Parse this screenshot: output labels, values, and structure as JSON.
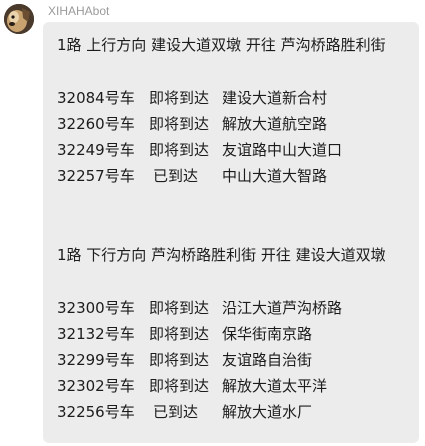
{
  "sender": {
    "name": "XIHAHAbot"
  },
  "message": {
    "up": {
      "header": "1路 上行方向 建设大道双墩 开往 芦沟桥路胜利街",
      "buses": [
        {
          "bus": "32084号车",
          "status": "即将到达",
          "location": "建设大道新合村"
        },
        {
          "bus": "32260号车",
          "status": "即将到达",
          "location": "解放大道航空路"
        },
        {
          "bus": "32249号车",
          "status": "即将到达",
          "location": "友谊路中山大道口"
        },
        {
          "bus": "32257号车",
          "status": "已到达",
          "location": "中山大道大智路"
        }
      ]
    },
    "down": {
      "header": "1路 下行方向 芦沟桥路胜利街 开往 建设大道双墩",
      "buses": [
        {
          "bus": "32300号车",
          "status": "即将到达",
          "location": "沿江大道芦沟桥路"
        },
        {
          "bus": "32132号车",
          "status": "即将到达",
          "location": "保华街南京路"
        },
        {
          "bus": "32299号车",
          "status": "即将到达",
          "location": "友谊路自治街"
        },
        {
          "bus": "32302号车",
          "status": "即将到达",
          "location": "解放大道太平洋"
        },
        {
          "bus": "32256号车",
          "status": "已到达",
          "location": "解放大道水厂"
        }
      ]
    }
  }
}
